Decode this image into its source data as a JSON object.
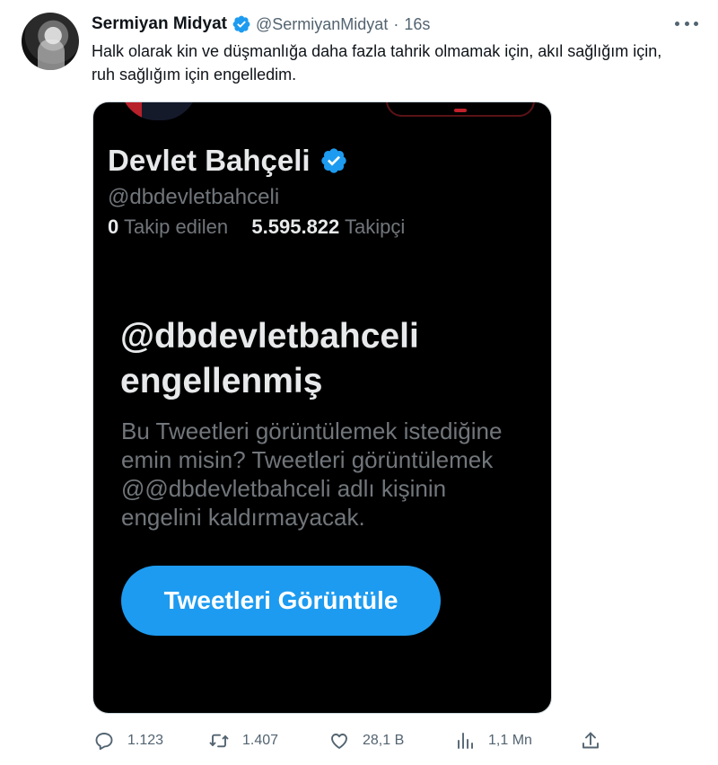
{
  "tweet": {
    "author_name": "Sermiyan Midyat",
    "author_handle": "@SermiyanMidyat",
    "separator": "·",
    "time": "16s",
    "text": "Halk olarak kin ve düşmanlığa daha fazla tahrik olmamak için, akıl sağlığım için, ruh sağlığım için engelledim."
  },
  "embedded_screenshot": {
    "profile_name": "Devlet Bahçeli",
    "profile_handle": "@dbdevletbahceli",
    "following_count": "0",
    "following_label": "Takip edilen",
    "followers_count": "5.595.822",
    "followers_label": "Takipçi",
    "blocked_title_line1": "@dbdevletbahceli",
    "blocked_title_line2": "engellenmiş",
    "blocked_description": "Bu Tweetleri görüntülemek istediğine emin misin? Tweetleri görüntülemek @@dbdevletbahceli adlı kişinin engelini kaldırmayacak.",
    "view_button_label": "Tweetleri Görüntüle"
  },
  "actions": {
    "replies": "1.123",
    "retweets": "1.407",
    "likes": "28,1 B",
    "views": "1,1 Mn"
  },
  "icons": {
    "more": "more-horizontal-icon",
    "verified": "verified-badge-icon",
    "reply": "reply-icon",
    "retweet": "retweet-icon",
    "like": "heart-icon",
    "views": "analytics-icon",
    "share": "share-icon"
  },
  "colors": {
    "accent": "#1d9bf0",
    "text_primary": "#0f1419",
    "text_secondary": "#536471",
    "media_bg": "#000000"
  }
}
